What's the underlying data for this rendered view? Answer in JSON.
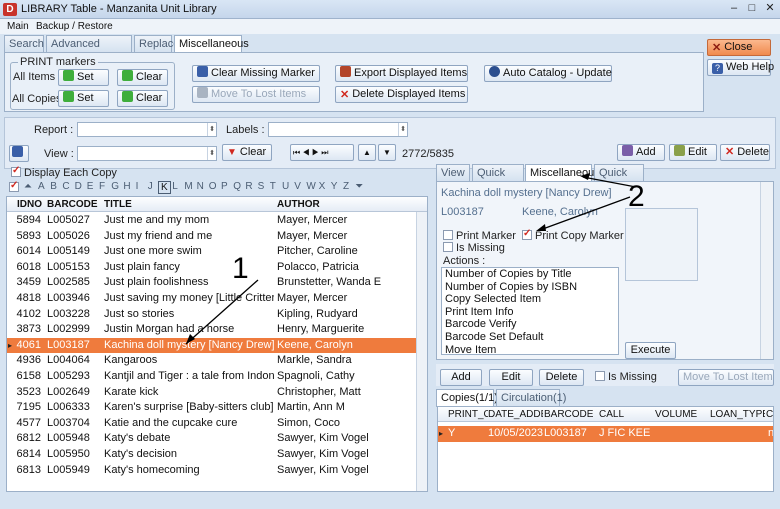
{
  "window": {
    "icon_letter": "D",
    "title": "LIBRARY Table - Manzanita Unit Library",
    "min": "–",
    "max": "□",
    "close": "✕"
  },
  "menu": [
    "Main",
    "Backup / Restore"
  ],
  "top_tabs": [
    "Search",
    "Advanced Search",
    "Replace",
    "Miscellaneous"
  ],
  "print_markers": {
    "title": "PRINT markers",
    "all_items": "All Items",
    "all_copies": "All Copies",
    "set": "Set",
    "clear": "Clear"
  },
  "actions": {
    "clear_missing": "Clear Missing Marker",
    "move_lost": "Move To Lost Items",
    "export_displayed": "Export Displayed Items",
    "delete_displayed": "Delete Displayed Items",
    "auto_catalog": "Auto Catalog - Update"
  },
  "right_buttons": {
    "close": "Close",
    "web_help": "Web Help"
  },
  "filters": {
    "report_label": "Report :",
    "labels_label": "Labels :",
    "view_label": "View :",
    "clear": "Clear",
    "nav_first": "⏮",
    "nav_prev": "◀",
    "nav_next": "▶",
    "nav_last": "⏭",
    "up": "▲",
    "down": "▼",
    "count": "2772/5835"
  },
  "record_buttons": {
    "add": "Add",
    "edit": "Edit",
    "delete": "Delete"
  },
  "display_each_copy": "Display Each Copy",
  "alphabet": [
    "A",
    "B",
    "C",
    "D",
    "E",
    "F",
    "G",
    "H",
    "I",
    "J",
    "K",
    "L",
    "M",
    "N",
    "O",
    "P",
    "Q",
    "R",
    "S",
    "T",
    "U",
    "V",
    "W",
    "X",
    "Y",
    "Z"
  ],
  "alpha_selected": "K",
  "main_grid": {
    "columns": [
      "IDNO",
      "BARCODE",
      "TITLE",
      "AUTHOR"
    ],
    "rows": [
      [
        "5894",
        "L005027",
        "Just me and my mom",
        "Mayer, Mercer"
      ],
      [
        "5893",
        "L005026",
        "Just my friend and me",
        "Mayer, Mercer"
      ],
      [
        "6014",
        "L005149",
        "Just one more swim",
        "Pitcher, Caroline"
      ],
      [
        "6018",
        "L005153",
        "Just plain fancy",
        "Polacco, Patricia"
      ],
      [
        "3459",
        "L002585",
        "Just plain foolishness",
        "Brunstetter, Wanda E"
      ],
      [
        "4818",
        "L003946",
        "Just saving my money [Little Critter]",
        "Mayer, Mercer"
      ],
      [
        "4102",
        "L003228",
        "Just so stories",
        "Kipling, Rudyard"
      ],
      [
        "3873",
        "L002999",
        "Justin Morgan had a horse",
        "Henry, Marguerite"
      ],
      [
        "4061",
        "L003187",
        "Kachina doll mystery [Nancy Drew]",
        "Keene, Carolyn"
      ],
      [
        "4936",
        "L004064",
        "Kangaroos",
        "Markle, Sandra"
      ],
      [
        "6158",
        "L005293",
        "Kantjil and Tiger : a tale from Indonesia",
        "Spagnoli, Cathy"
      ],
      [
        "3523",
        "L002649",
        "Karate kick",
        "Christopher, Matt"
      ],
      [
        "7195",
        "L006333",
        "Karen's surprise [Baby-sitters club] [Ba",
        "Martin, Ann M"
      ],
      [
        "4577",
        "L003704",
        "Katie and the cupcake cure",
        "Simon, Coco"
      ],
      [
        "6812",
        "L005948",
        "Katy's debate",
        "Sawyer, Kim Vogel"
      ],
      [
        "6814",
        "L005950",
        "Katy's decision",
        "Sawyer, Kim Vogel"
      ],
      [
        "6813",
        "L005949",
        "Katy's homecoming",
        "Sawyer, Kim Vogel"
      ]
    ],
    "selected_index": 8,
    "row_marker": "▸"
  },
  "right_tabs": [
    "View",
    "Quick Edit",
    "Miscellaneous",
    "Quick Add"
  ],
  "misc": {
    "title": "Kachina doll mystery [Nancy Drew]",
    "barcode": "L003187",
    "author": "Keene, Carolyn",
    "print_marker": "Print Marker",
    "is_missing": "Is Missing",
    "print_copy_marker": "Print Copy Marker",
    "actions_label": "Actions :",
    "actions": [
      "Number of Copies by Title",
      "Number of Copies by ISBN",
      "Copy Selected Item",
      "Print Item Info",
      "Barcode Verify",
      "Barcode Set Default",
      "Move Item"
    ],
    "execute": "Execute"
  },
  "copies_toolbar": {
    "add": "Add",
    "edit": "Edit",
    "delete": "Delete",
    "is_missing": "Is Missing",
    "move_lost": "Move To Lost Items"
  },
  "copies_tabs": [
    "Copies(1/1)",
    "Circulation(1)"
  ],
  "copies_grid": {
    "columns": [
      "PRINT_C",
      "DATE_ADDE",
      "BARCODE",
      "CALL",
      "VOLUME",
      "LOAN_TYPE",
      "C"
    ],
    "row": [
      "Y",
      "10/05/2023",
      "L003187",
      "J FIC KEE",
      "",
      "",
      "n"
    ],
    "row_marker": "▸"
  },
  "annotations": [
    "1",
    "2"
  ],
  "colors": {
    "selection": "#ef7b3d",
    "panel": "#e9f0f8",
    "accent_close": "#f08a4e"
  }
}
